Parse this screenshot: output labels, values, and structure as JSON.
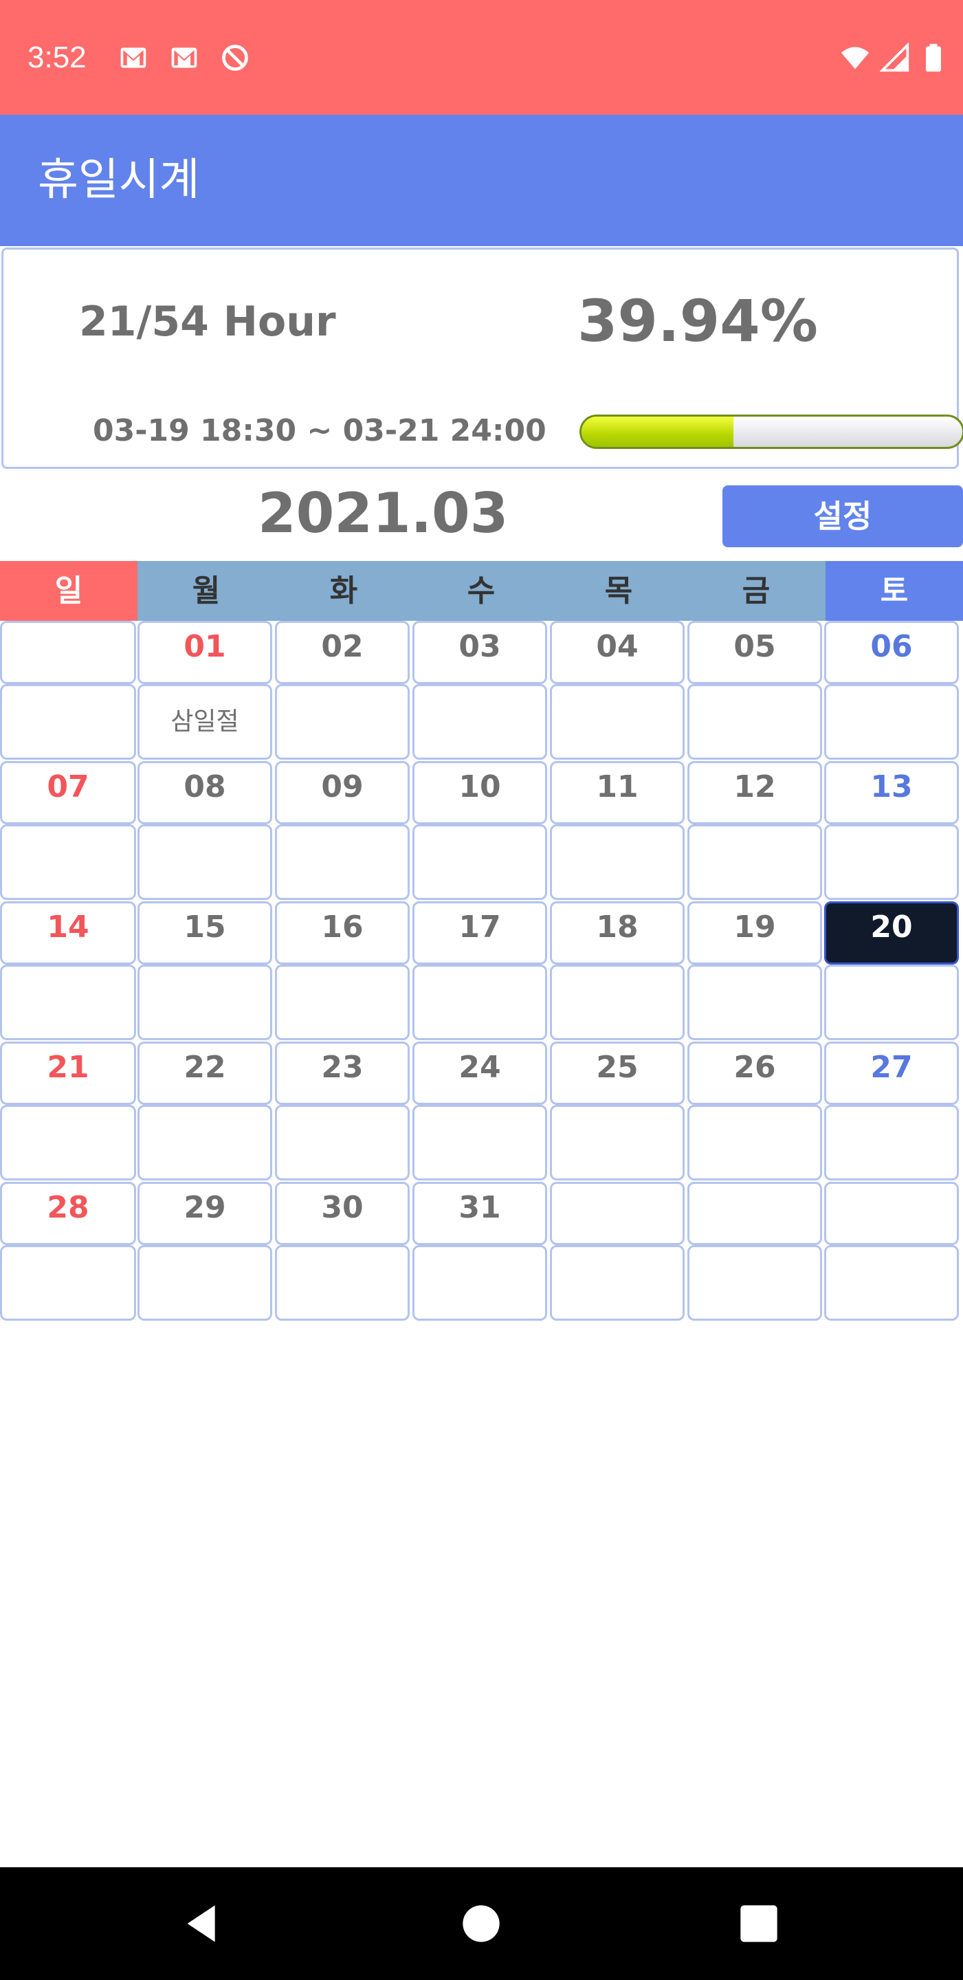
{
  "status_bar": {
    "time": "3:52",
    "left_icons": [
      "gmail-icon",
      "gmail-icon",
      "do-not-disturb-icon"
    ],
    "right_icons": [
      "wifi-icon",
      "cell-signal-icon",
      "battery-icon"
    ]
  },
  "app_bar": {
    "title": "휴일시계"
  },
  "info_card": {
    "hours": "21/54 Hour",
    "percent": "39.94%",
    "range": "03-19 18:30 ~ 03-21 24:00",
    "progress_fraction": 0.3994,
    "progress_color": "#b8d600"
  },
  "calendar": {
    "month": "2021.03",
    "settings_label": "설정",
    "weekdays": [
      "일",
      "월",
      "화",
      "수",
      "목",
      "금",
      "토"
    ],
    "weeks": [
      {
        "days": [
          "",
          "01",
          "02",
          "03",
          "04",
          "05",
          "06"
        ],
        "notes": [
          "",
          "삼일절",
          "",
          "",
          "",
          "",
          ""
        ]
      },
      {
        "days": [
          "07",
          "08",
          "09",
          "10",
          "11",
          "12",
          "13"
        ],
        "notes": [
          "",
          "",
          "",
          "",
          "",
          "",
          ""
        ]
      },
      {
        "days": [
          "14",
          "15",
          "16",
          "17",
          "18",
          "19",
          "20"
        ],
        "notes": [
          "",
          "",
          "",
          "",
          "",
          "",
          ""
        ]
      },
      {
        "days": [
          "21",
          "22",
          "23",
          "24",
          "25",
          "26",
          "27"
        ],
        "notes": [
          "",
          "",
          "",
          "",
          "",
          "",
          ""
        ]
      },
      {
        "days": [
          "28",
          "29",
          "30",
          "31",
          "",
          "",
          ""
        ],
        "notes": [
          "",
          "",
          "",
          "",
          "",
          "",
          ""
        ]
      }
    ],
    "today": "20",
    "holidays": [
      "01"
    ],
    "colors": {
      "sunday": "#f2555a",
      "saturday": "#5778df",
      "today_bg": "#101a2b"
    }
  },
  "nav_bar": {
    "icons": [
      "back-icon",
      "home-icon",
      "recents-icon"
    ]
  }
}
